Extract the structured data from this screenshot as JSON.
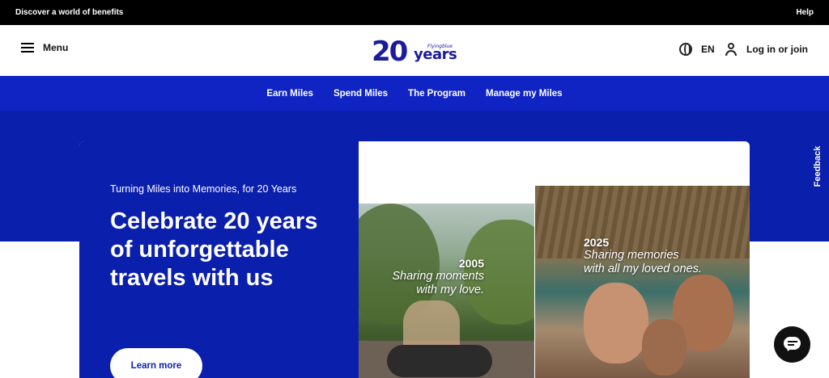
{
  "topbar": {
    "promo": "Discover a world of benefits",
    "help": "Help"
  },
  "header": {
    "menu_label": "Menu",
    "logo": {
      "number": "20",
      "word": "years",
      "brand": "Flyingblue"
    },
    "language": "EN",
    "login": "Log in or join"
  },
  "nav": {
    "items": [
      {
        "label": "Earn Miles"
      },
      {
        "label": "Spend Miles"
      },
      {
        "label": "The Program"
      },
      {
        "label": "Manage my Miles"
      }
    ]
  },
  "hero": {
    "kicker": "Turning Miles into Memories, for 20 Years",
    "title": "Celebrate 20 years of unforgettable travels with us",
    "cta": "Learn more",
    "photos": [
      {
        "year": "2005",
        "line1": "Sharing moments",
        "line2": "with my love."
      },
      {
        "year": "2025",
        "line1": "Sharing memories",
        "line2": "with all my loved ones."
      }
    ]
  },
  "feedback": "Feedback",
  "colors": {
    "brand_blue": "#0b1fad",
    "nav_blue": "#1024c3",
    "logo_blue": "#1b1b9c"
  },
  "icons": [
    "menu-icon",
    "globe-icon",
    "user-icon",
    "chat-icon"
  ]
}
